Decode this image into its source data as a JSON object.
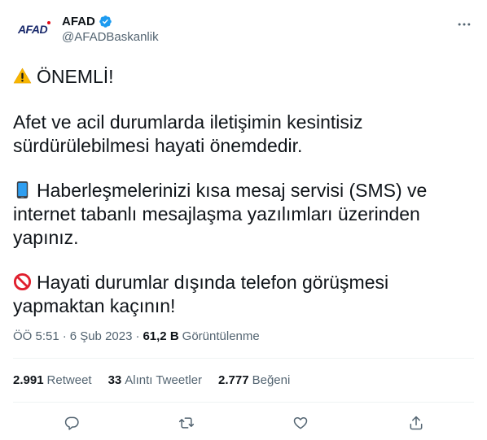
{
  "author": {
    "display_name": "AFAD",
    "handle": "@AFADBaskanlik",
    "avatar_text": "AFAD",
    "verified_icon": "verified-badge-icon"
  },
  "tweet": {
    "line1": "ÖNEMLİ!",
    "line2": "Afet ve acil durumlarda iletişimin kesintisiz sürdürülebilmesi hayati önemdedir.",
    "line3": "Haberleşmelerinizi kısa mesaj servisi (SMS) ve internet tabanlı mesajlaşma yazılımları üzerinden yapınız.",
    "line4": "Hayati durumlar dışında telefon görüşmesi yapmaktan kaçının!"
  },
  "meta": {
    "time": "ÖÖ 5:51",
    "sep1": "·",
    "date": "6 Şub 2023",
    "sep2": "·",
    "views": "61,2 B",
    "views_label": "Görüntülenme"
  },
  "stats": {
    "retweets": "2.991",
    "retweets_label": "Retweet",
    "quotes": "33",
    "quotes_label": "Alıntı Tweetler",
    "likes": "2.777",
    "likes_label": "Beğeni"
  },
  "colors": {
    "text": "#0f1419",
    "muted": "#536471",
    "divider": "#eff3f4",
    "verified": "#1d9bf0"
  }
}
